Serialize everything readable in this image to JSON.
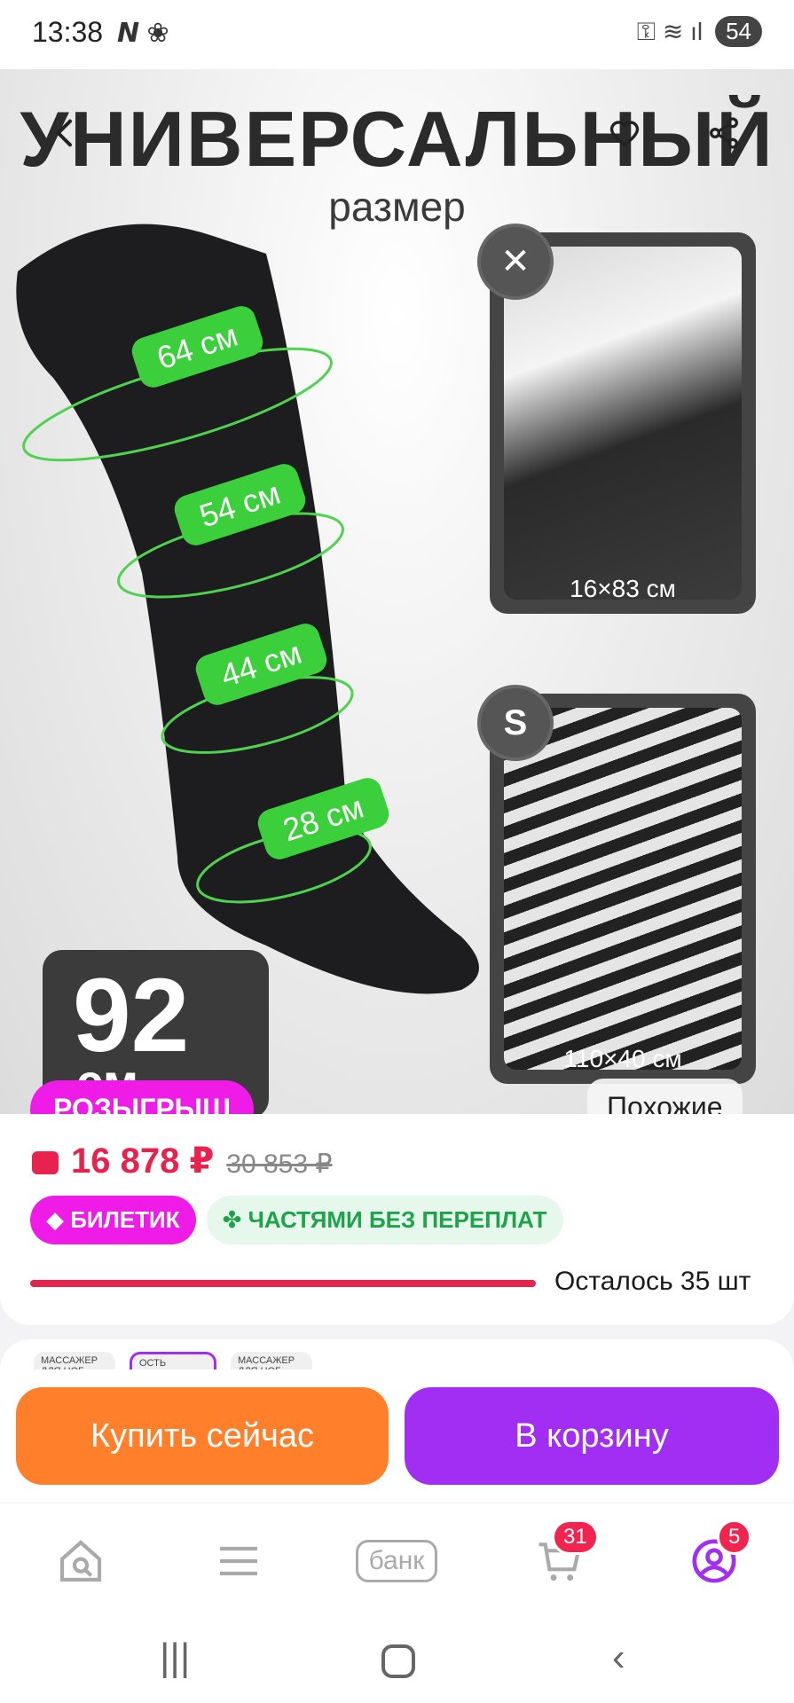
{
  "status_bar": {
    "time": "13:38",
    "left_icons": "𝙉 ❀",
    "right_icons": "⚿ ≋ ıl",
    "battery": "54"
  },
  "hero": {
    "title": "УНИВЕРСАЛЬНЫЙ",
    "subtitle": "размер",
    "measurements": [
      "64 см",
      "54 см",
      "44 см",
      "28 см"
    ],
    "photo_top_caption": "16×83 см",
    "photo_bottom_caption": "110×40 см",
    "photo_top_badge": "✕",
    "photo_bottom_badge": "S",
    "length_value": "92",
    "length_unit": "см",
    "promo_label": "РОЗЫГРЫШ",
    "similar_label": "Похожие"
  },
  "price": {
    "current": "16 878 ₽",
    "old": "30 853 ₽",
    "tag_ticket": "◆ БИЛЕТИК",
    "tag_installments": "✤ ЧАСТЯМИ БЕЗ ПЕРЕПЛАТ",
    "stock_text": "Осталось 35 шт"
  },
  "thumbs": [
    "МАССАЖЕР ДЛЯ НОГ",
    "ОСТЬ ЛИМФОДРЕНАЖ",
    "МАССАЖЕР ДЛЯ НОГ"
  ],
  "actions": {
    "buy_now": "Купить сейчас",
    "add_to_cart": "В корзину"
  },
  "nav": {
    "bank_label": "банк",
    "cart_count": "31",
    "profile_count": "5"
  },
  "colors": {
    "price": "#e8224e",
    "promo": "#ee1ce6",
    "buy": "#ff7f2a",
    "cart": "#a12ef2",
    "measure": "#3ccf3c"
  }
}
